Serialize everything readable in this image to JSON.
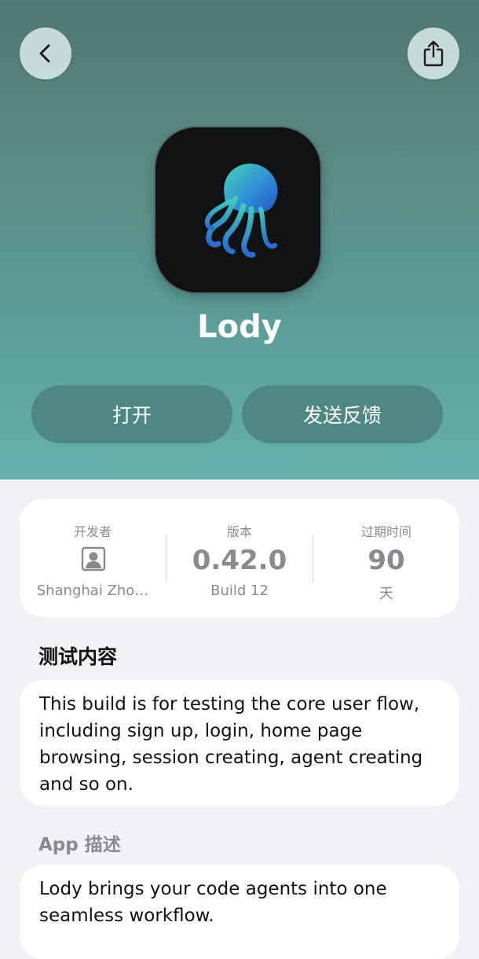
{
  "app": {
    "name": "Lody",
    "icon": "jellyfish-icon"
  },
  "nav": {
    "back_icon": "chevron-left-icon",
    "share_icon": "share-icon"
  },
  "actions": {
    "open_label": "打开",
    "feedback_label": "发送反馈"
  },
  "info": {
    "developer": {
      "label": "开发者",
      "value": "Shanghai Zho…",
      "icon": "person-icon"
    },
    "version": {
      "label": "版本",
      "value": "0.42.0",
      "sub": "Build 12"
    },
    "expiry": {
      "label": "过期时间",
      "value": "90",
      "sub": "天"
    }
  },
  "test_content": {
    "title": "测试内容",
    "text": "This build is for testing the core user flow, including sign up, login, home page browsing, session creating, agent creating and so on."
  },
  "description": {
    "title": "App 描述",
    "text": "Lody brings your code agents into one seamless workflow."
  },
  "colors": {
    "hero_top": "#4f7672",
    "hero_bottom": "#64b0ae",
    "pill": "#4f8784",
    "background": "#f2f2f6"
  }
}
